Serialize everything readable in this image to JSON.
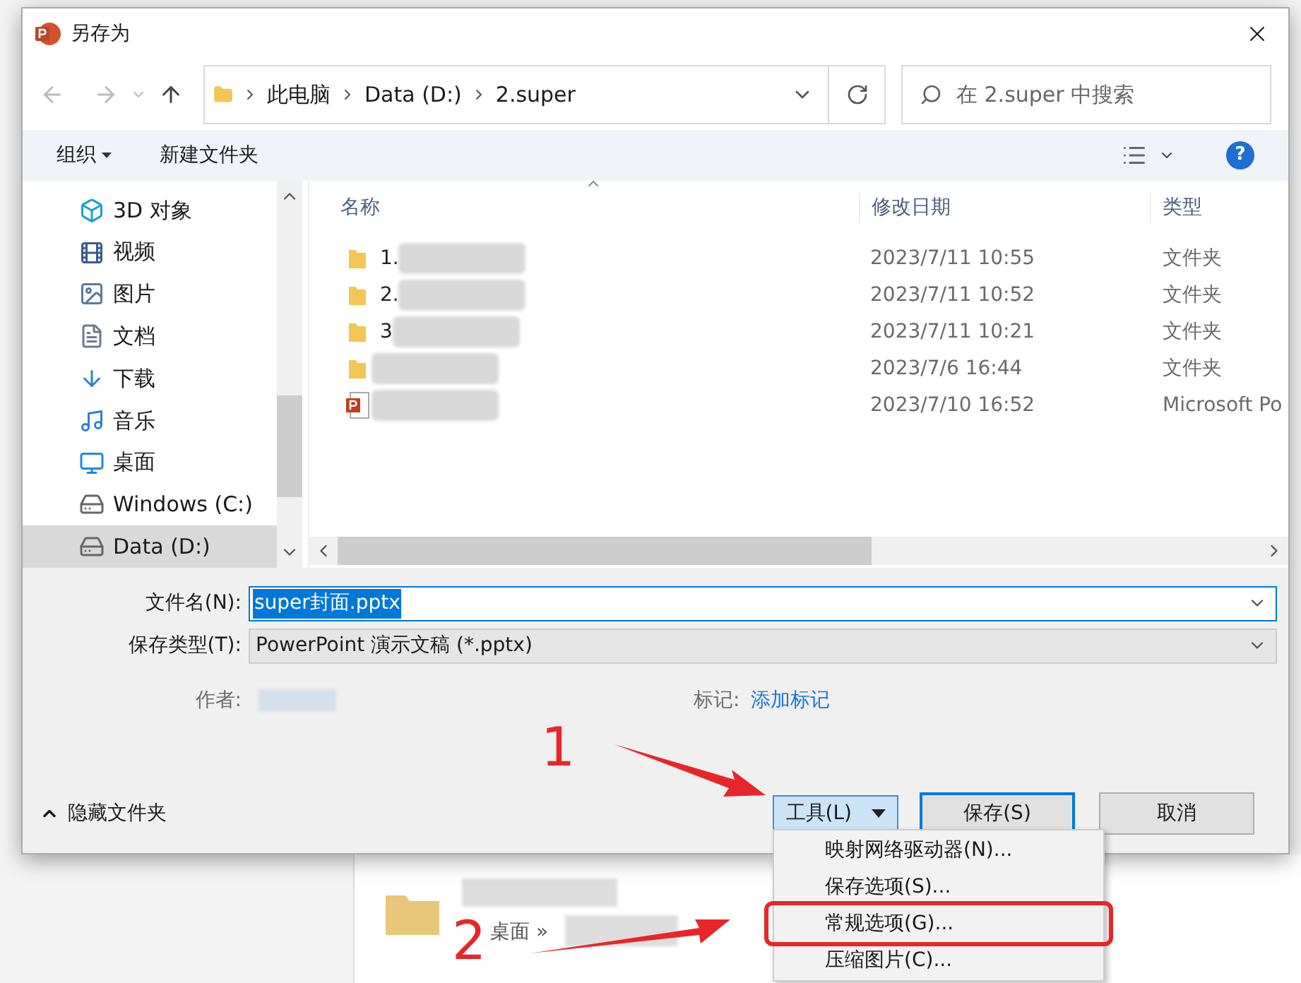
{
  "dialog": {
    "title": "另存为"
  },
  "address": {
    "crumbs": [
      "此电脑",
      "Data (D:)",
      "2.super"
    ]
  },
  "search": {
    "placeholder": "在 2.super 中搜索"
  },
  "toolbar": {
    "organize": "组织",
    "new_folder": "新建文件夹",
    "help": "?"
  },
  "nav_items": [
    {
      "label": "3D 对象",
      "kind": "cube",
      "selected": false
    },
    {
      "label": "视频",
      "kind": "video",
      "selected": false
    },
    {
      "label": "图片",
      "kind": "picture",
      "selected": false
    },
    {
      "label": "文档",
      "kind": "document",
      "selected": false
    },
    {
      "label": "下载",
      "kind": "download",
      "selected": false
    },
    {
      "label": "音乐",
      "kind": "music",
      "selected": false
    },
    {
      "label": "桌面",
      "kind": "desktop",
      "selected": false
    },
    {
      "label": "Windows (C:)",
      "kind": "drive",
      "selected": false
    },
    {
      "label": "Data (D:)",
      "kind": "drive",
      "selected": true
    }
  ],
  "columns": [
    "名称",
    "修改日期",
    "类型"
  ],
  "files": [
    {
      "name": "1.",
      "kind": "folder",
      "modified": "2023/7/11 10:55",
      "type": "文件夹"
    },
    {
      "name": "2.",
      "kind": "folder",
      "modified": "2023/7/11 10:52",
      "type": "文件夹"
    },
    {
      "name": "3",
      "kind": "folder",
      "modified": "2023/7/11 10:21",
      "type": "文件夹"
    },
    {
      "kind": "folder",
      "modified": "2023/7/6 16:44",
      "type": "文件夹"
    },
    {
      "kind": "pptx",
      "modified": "2023/7/10 16:52",
      "type": "Microsoft Po"
    }
  ],
  "form": {
    "filename_label": "文件名(N):",
    "filename": "super封面.pptx",
    "filetype_label": "保存类型(T):",
    "filetype": "PowerPoint 演示文稿 (*.pptx)",
    "author_label": "作者:",
    "tags_label": "标记:",
    "tags_link": "添加标记"
  },
  "hide_folders": "隐藏文件夹",
  "buttons": {
    "tools": "工具(L)",
    "save": "保存(S)",
    "cancel": "取消"
  },
  "tools_menu": [
    {
      "label": "映射网络驱动器(N)...",
      "highlighted": false
    },
    {
      "label": "保存选项(S)...",
      "highlighted": false
    },
    {
      "label": "常规选项(G)...",
      "highlighted": true
    },
    {
      "label": "压缩图片(C)...",
      "highlighted": false
    }
  ],
  "background": {
    "breadcrumb": "桌面 »"
  },
  "annotations": [
    {
      "label": "1"
    },
    {
      "label": "2"
    }
  ]
}
